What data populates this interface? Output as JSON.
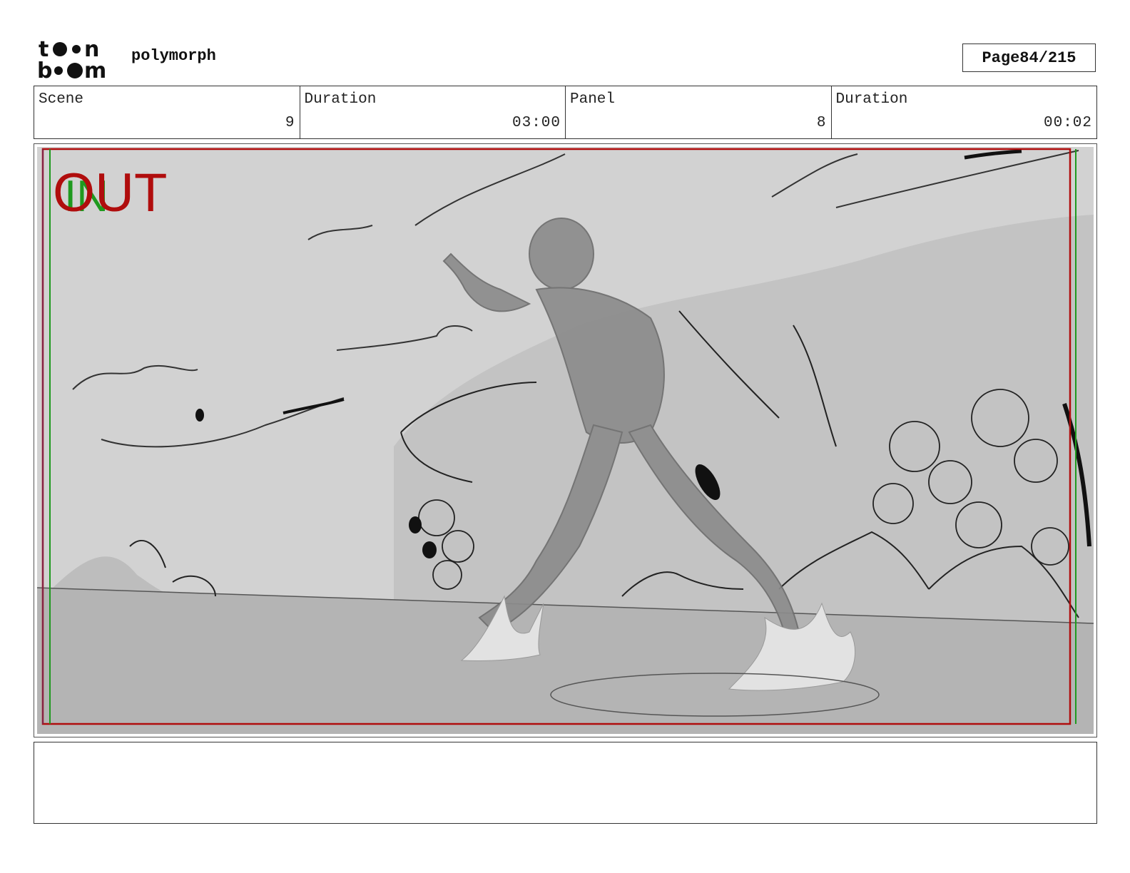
{
  "header": {
    "logo": {
      "text": "toon boom",
      "icon": "toon-boom-logo"
    },
    "project_name": "polymorph",
    "page_label": "Page",
    "page_number": "84/215"
  },
  "info": {
    "scene_label": "Scene",
    "scene_value": "9",
    "scene_duration_label": "Duration",
    "scene_duration_value": "03:00",
    "panel_label": "Panel",
    "panel_value": "8",
    "panel_duration_label": "Duration",
    "panel_duration_value": "00:02"
  },
  "panel": {
    "overlay_in_text": "IN",
    "overlay_out_text": "OUT",
    "colors": {
      "in": "#1f9a1f",
      "out": "#b00d0d",
      "sky": "#d2d2d2",
      "ground": "#b6b6b6",
      "hill": "#c4c4c4",
      "figure": "#8e8e8e"
    }
  },
  "caption": {
    "text": ""
  }
}
